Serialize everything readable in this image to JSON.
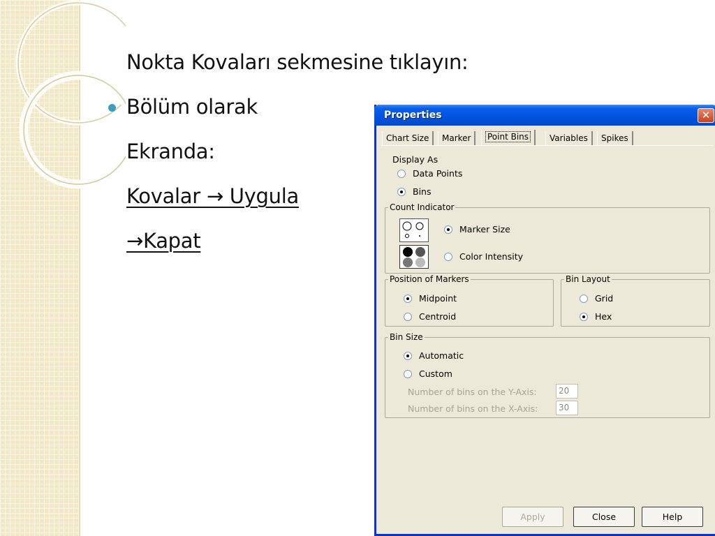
{
  "slide": {
    "line1": "Nokta Kovaları sekmesine tıklayın:",
    "line2": "Bölüm olarak",
    "line3": "Ekranda:",
    "line4": "Kovalar → Uygula",
    "line5": "→Kapat"
  },
  "dialog": {
    "title": "Properties",
    "close_glyph": "✕",
    "tabs": [
      "Chart Size",
      "Marker",
      "Point Bins",
      "Variables",
      "Spikes"
    ],
    "active_tab": "Point Bins",
    "display_as": {
      "label": "Display As",
      "options": [
        "Data Points",
        "Bins"
      ],
      "selected": "Bins"
    },
    "count_indicator": {
      "label": "Count Indicator",
      "options": [
        "Marker Size",
        "Color Intensity"
      ],
      "selected": "Marker Size"
    },
    "position_of_markers": {
      "label": "Position of Markers",
      "options": [
        "Midpoint",
        "Centroid"
      ],
      "selected": "Midpoint"
    },
    "bin_layout": {
      "label": "Bin Layout",
      "options": [
        "Grid",
        "Hex"
      ],
      "selected": "Hex"
    },
    "bin_size": {
      "label": "Bin Size",
      "options": [
        "Automatic",
        "Custom"
      ],
      "selected": "Automatic",
      "y_axis_label": "Number of bins on the Y-Axis:",
      "y_axis_value": "20",
      "x_axis_label": "Number of bins on the X-Axis:",
      "x_axis_value": "30"
    },
    "buttons": {
      "apply": "Apply",
      "close": "Close",
      "help": "Help"
    }
  },
  "colors": {
    "titlebar": "#0254e0",
    "dialog_bg": "#ece9d8",
    "bullet": "#3b9ec0",
    "strip": "#f3e7c4"
  }
}
